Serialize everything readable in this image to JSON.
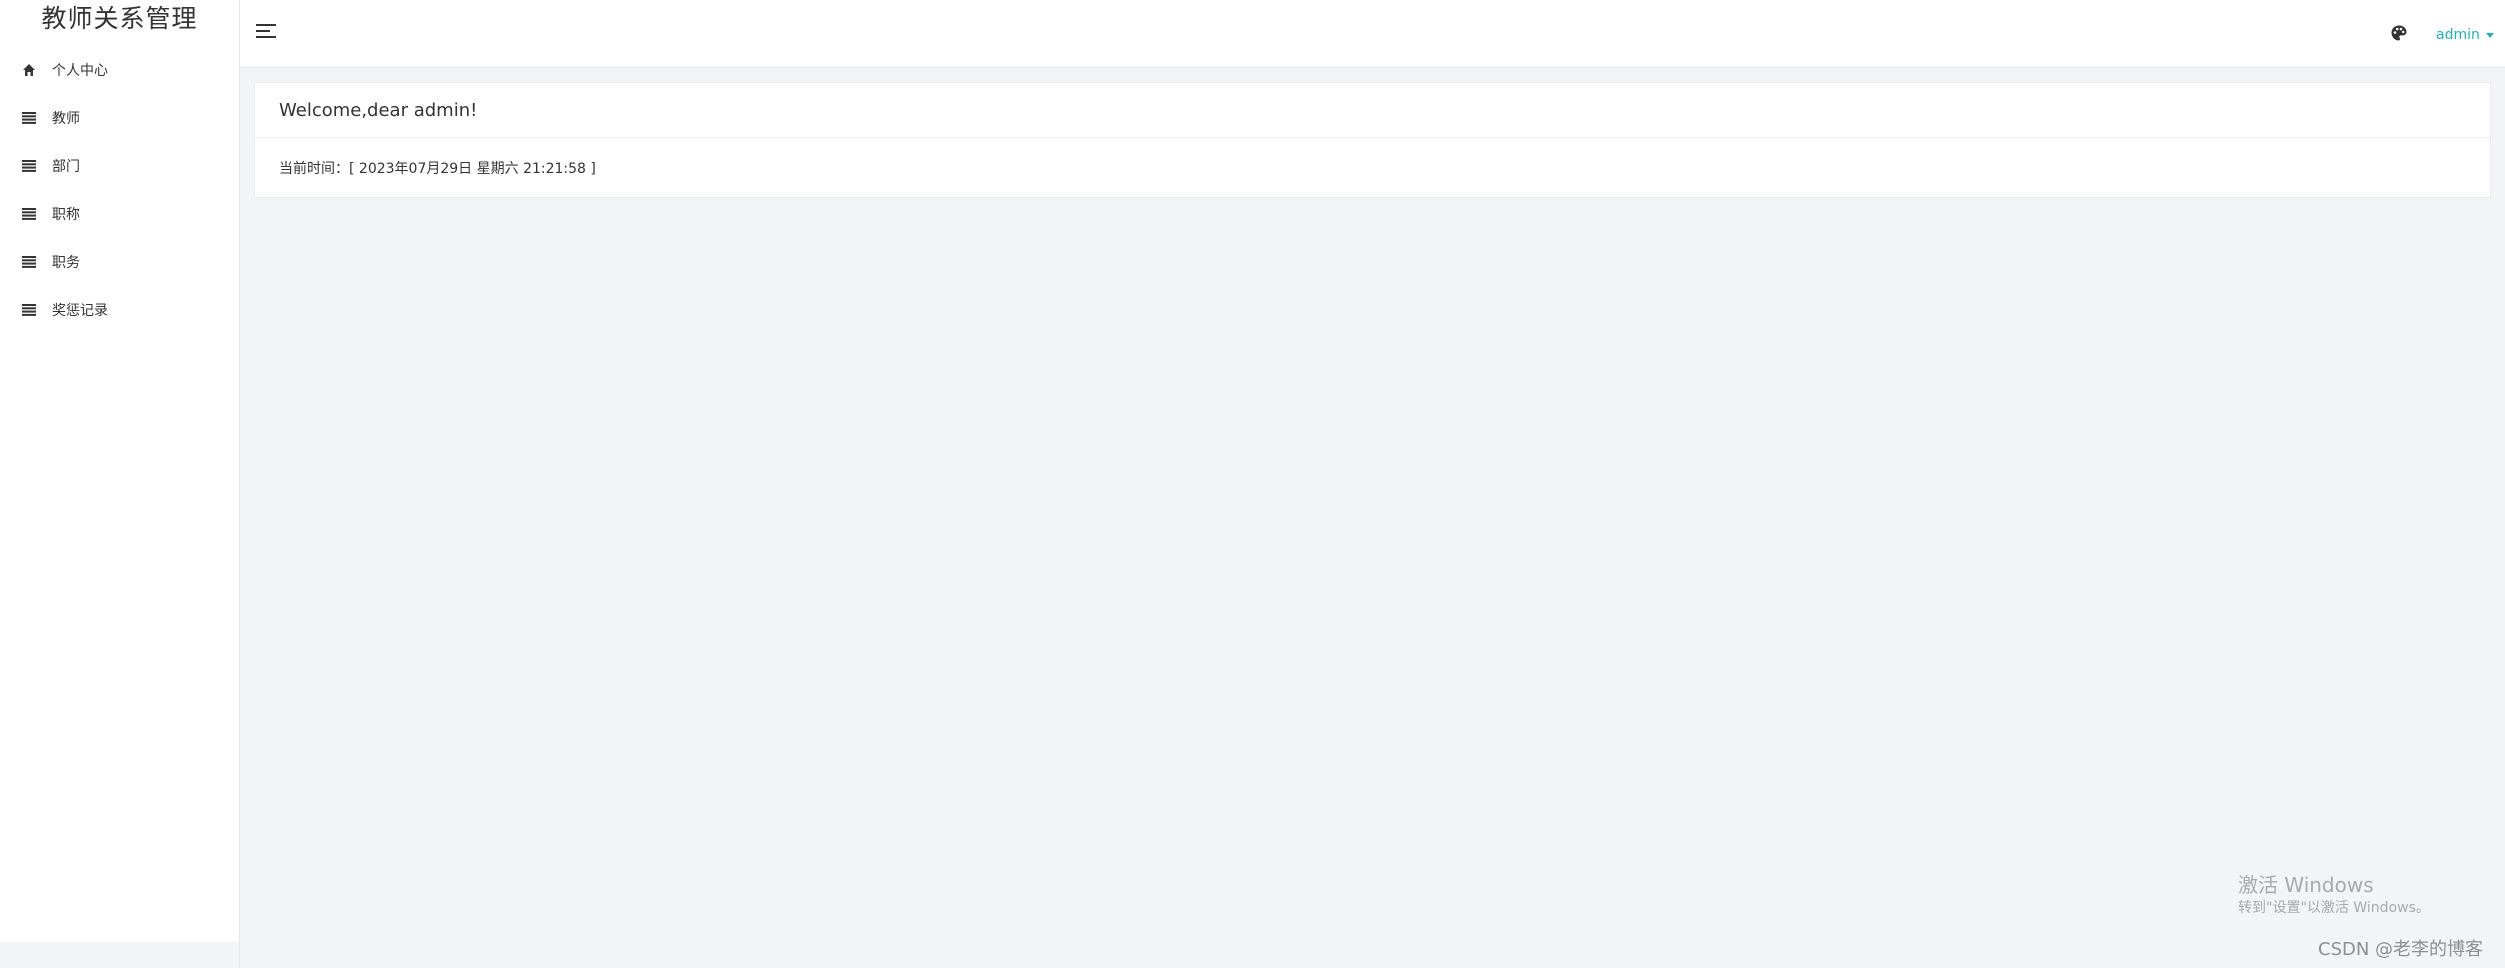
{
  "sidebar": {
    "brand": "教师关系管理",
    "items": [
      {
        "label": "个人中心",
        "icon": "home-icon"
      },
      {
        "label": "教师",
        "icon": "list-icon"
      },
      {
        "label": "部门",
        "icon": "list-icon"
      },
      {
        "label": "职称",
        "icon": "list-icon"
      },
      {
        "label": "职务",
        "icon": "list-icon"
      },
      {
        "label": "奖惩记录",
        "icon": "list-icon"
      }
    ]
  },
  "header": {
    "menu_toggle_icon": "hamburger-icon",
    "theme_icon": "palette-icon",
    "user": "admin",
    "accent": "#1fb3b3"
  },
  "welcome": {
    "title": "Welcome,dear admin!",
    "time_text": "当前时间：[ 2023年07月29日 星期六 21:21:58 ]"
  },
  "overlays": {
    "activate_title": "激活 Windows",
    "activate_sub": "转到\"设置\"以激活 Windows。",
    "watermark": "CSDN @老李的博客"
  }
}
